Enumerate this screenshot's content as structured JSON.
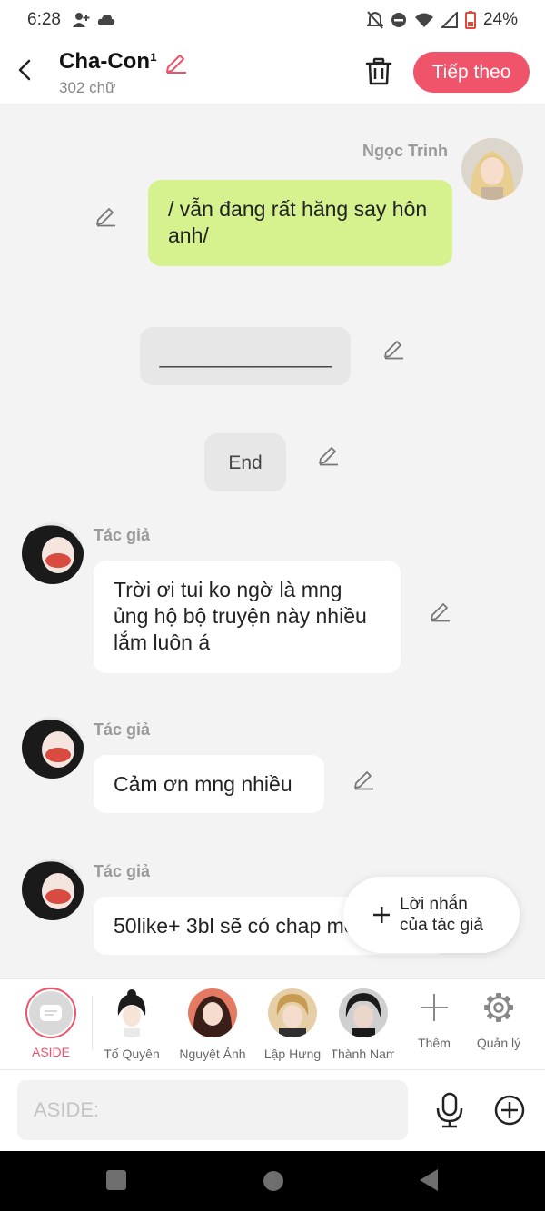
{
  "status_bar": {
    "time": "6:28",
    "battery": "24%"
  },
  "header": {
    "title": "Cha-Con¹",
    "word_count": "302 chữ",
    "next_label": "Tiếp theo"
  },
  "messages": [
    {
      "sender": "Ngọc Trinh",
      "text": "/ vẫn đang rất hăng say hôn anh/",
      "style": "green"
    },
    {
      "text": "________________",
      "style": "grey"
    },
    {
      "text": "End",
      "style": "grey"
    },
    {
      "sender": "Tác giả",
      "text": "Trời ơi tui ko ngờ là mng ủng hộ bộ truyện này nhiều lắm luôn á",
      "style": "white"
    },
    {
      "sender": "Tác giả",
      "text": "Cảm ơn mng nhiều",
      "style": "white"
    },
    {
      "sender": "Tác giả",
      "text": "50like+ 3bl sẽ có chap mới",
      "style": "white"
    }
  ],
  "author_note_button": {
    "line1": "Lời nhắn",
    "line2": "của tác giả"
  },
  "characters": [
    {
      "label": "ASIDE"
    },
    {
      "label": "Tố Quyên"
    },
    {
      "label": "Nguyệt Ảnh"
    },
    {
      "label": "Lập Hưng"
    },
    {
      "label": "Thành Nam"
    },
    {
      "label": "Thêm"
    },
    {
      "label": "Quản lý"
    }
  ],
  "input": {
    "placeholder": "ASIDE:"
  },
  "colors": {
    "accent": "#f0546b",
    "green_bubble": "#d6f28e"
  }
}
